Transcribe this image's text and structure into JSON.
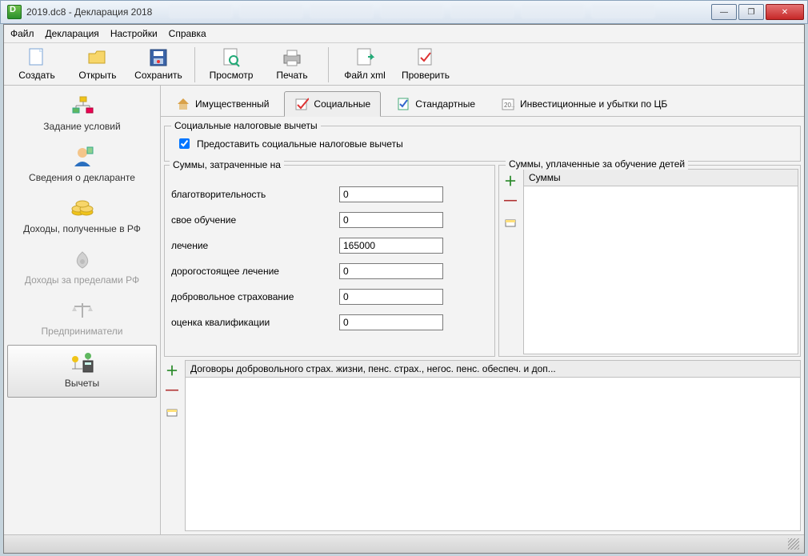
{
  "window": {
    "title": "2019.dc8 - Декларация 2018"
  },
  "menu": {
    "file": "Файл",
    "decl": "Декларация",
    "settings": "Настройки",
    "help": "Справка"
  },
  "toolbar": {
    "create": "Создать",
    "open": "Открыть",
    "save": "Сохранить",
    "preview": "Просмотр",
    "print": "Печать",
    "xml": "Файл xml",
    "check": "Проверить"
  },
  "sidebar": {
    "items": [
      {
        "label": "Задание условий"
      },
      {
        "label": "Сведения о декларанте"
      },
      {
        "label": "Доходы, полученные в РФ"
      },
      {
        "label": "Доходы за пределами РФ"
      },
      {
        "label": "Предприниматели"
      },
      {
        "label": "Вычеты"
      }
    ]
  },
  "tabs": {
    "property": "Имущественный",
    "social": "Социальные",
    "standard": "Стандартные",
    "invest": "Инвестиционные и убытки по ЦБ"
  },
  "social": {
    "legend": "Социальные налоговые вычеты",
    "provide_label": "Предоставить социальные налоговые вычеты",
    "provide_checked": true,
    "spent_group": "Суммы, затраченные на",
    "fields": {
      "charity": {
        "label": "благотворительность",
        "value": "0"
      },
      "own_edu": {
        "label": "свое обучение",
        "value": "0"
      },
      "treatment": {
        "label": "лечение",
        "value": "165000"
      },
      "expensive": {
        "label": "дорогостоящее лечение",
        "value": "0"
      },
      "insurance": {
        "label": "добровольное страхование",
        "value": "0"
      },
      "qualif": {
        "label": "оценка квалификации",
        "value": "0"
      }
    },
    "children_group": "Суммы, уплаченные за обучение детей",
    "children_header": "Суммы",
    "bottom_header": "Договоры добровольного страх. жизни, пенс. страх., негос. пенс. обеспеч. и доп..."
  }
}
